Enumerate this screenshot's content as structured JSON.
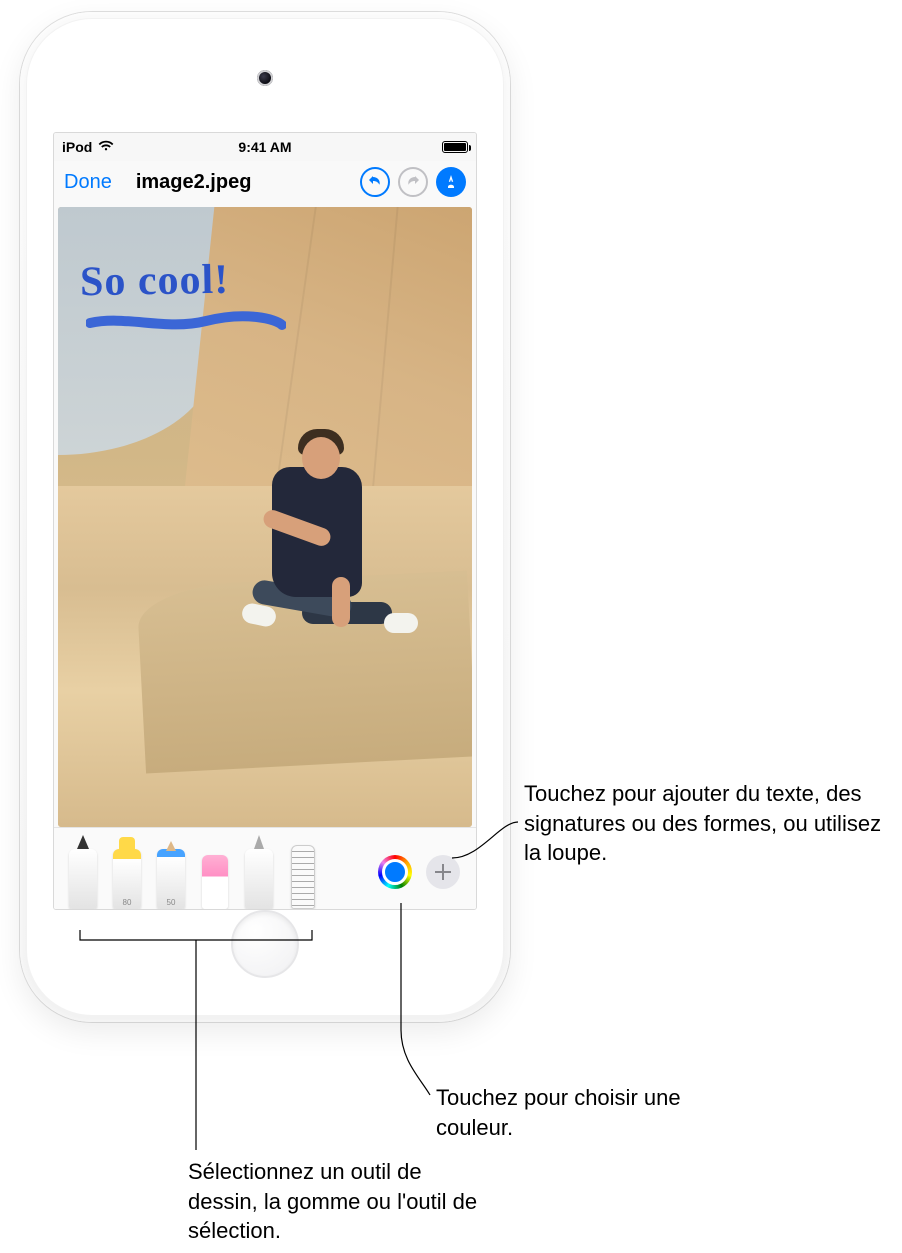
{
  "status": {
    "device": "iPod",
    "time": "9:41 AM"
  },
  "nav": {
    "done": "Done",
    "title": "image2.jpeg"
  },
  "annotation": {
    "handwriting": "So cool!"
  },
  "tools": {
    "marker_size": "80",
    "pencil_size": "50"
  },
  "callouts": {
    "add": "Touchez pour ajouter du texte, des signatures ou des formes, ou utilisez la loupe.",
    "color": "Touchez pour choisir une couleur.",
    "tools": "Sélectionnez un outil de dessin, la gomme ou l'outil de sélection."
  }
}
